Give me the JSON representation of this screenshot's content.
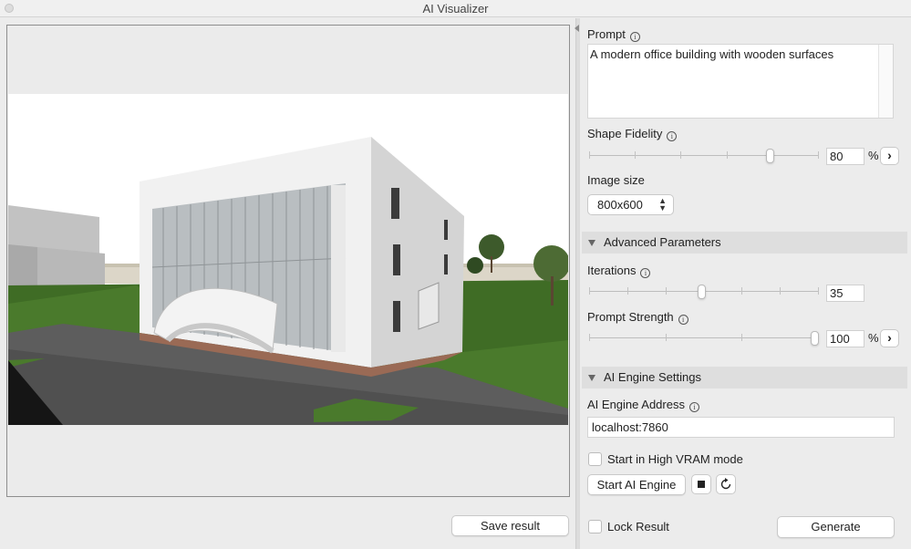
{
  "window": {
    "title": "AI Visualizer"
  },
  "preview": {
    "save_label": "Save result"
  },
  "prompt": {
    "label": "Prompt",
    "value": "A modern office building with wooden surfaces"
  },
  "shape_fidelity": {
    "label": "Shape Fidelity",
    "value": "80",
    "unit": "%",
    "fraction": 0.8
  },
  "image_size": {
    "label": "Image size",
    "value": "800x600"
  },
  "advanced": {
    "header": "Advanced Parameters",
    "iterations": {
      "label": "Iterations",
      "value": "35",
      "fraction": 0.49
    },
    "prompt_strength": {
      "label": "Prompt Strength",
      "value": "100",
      "unit": "%",
      "fraction": 1.0
    }
  },
  "engine": {
    "header": "AI Engine Settings",
    "address_label": "AI Engine Address",
    "address_value": "localhost:7860",
    "high_vram_label": "Start in High VRAM mode",
    "start_label": "Start AI Engine"
  },
  "footer": {
    "lock_label": "Lock Result",
    "generate_label": "Generate"
  },
  "icons": {
    "info": "info-icon",
    "stop": "stop-icon",
    "refresh": "refresh-icon",
    "chevron": "chevron-right-icon"
  }
}
